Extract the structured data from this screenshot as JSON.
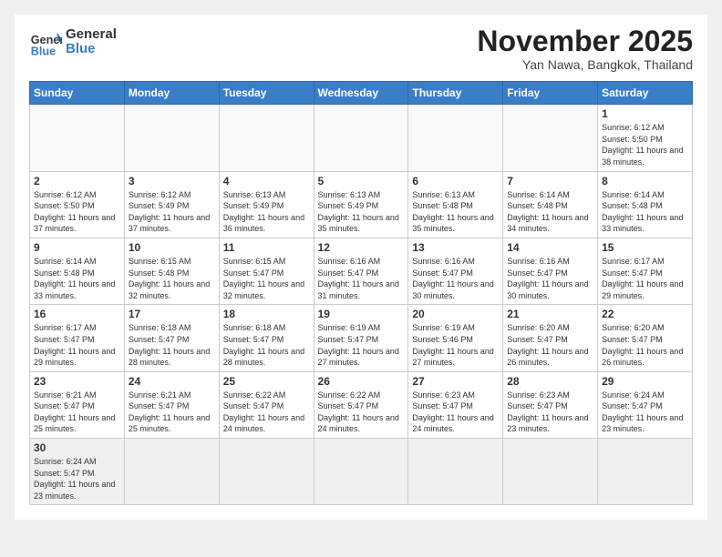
{
  "header": {
    "logo_general": "General",
    "logo_blue": "Blue",
    "month_title": "November 2025",
    "subtitle": "Yan Nawa, Bangkok, Thailand"
  },
  "weekdays": [
    "Sunday",
    "Monday",
    "Tuesday",
    "Wednesday",
    "Thursday",
    "Friday",
    "Saturday"
  ],
  "days": {
    "1": {
      "sunrise": "6:12 AM",
      "sunset": "5:50 PM",
      "daylight": "11 hours and 38 minutes."
    },
    "2": {
      "sunrise": "6:12 AM",
      "sunset": "5:50 PM",
      "daylight": "11 hours and 37 minutes."
    },
    "3": {
      "sunrise": "6:12 AM",
      "sunset": "5:49 PM",
      "daylight": "11 hours and 37 minutes."
    },
    "4": {
      "sunrise": "6:13 AM",
      "sunset": "5:49 PM",
      "daylight": "11 hours and 36 minutes."
    },
    "5": {
      "sunrise": "6:13 AM",
      "sunset": "5:49 PM",
      "daylight": "11 hours and 35 minutes."
    },
    "6": {
      "sunrise": "6:13 AM",
      "sunset": "5:48 PM",
      "daylight": "11 hours and 35 minutes."
    },
    "7": {
      "sunrise": "6:14 AM",
      "sunset": "5:48 PM",
      "daylight": "11 hours and 34 minutes."
    },
    "8": {
      "sunrise": "6:14 AM",
      "sunset": "5:48 PM",
      "daylight": "11 hours and 33 minutes."
    },
    "9": {
      "sunrise": "6:14 AM",
      "sunset": "5:48 PM",
      "daylight": "11 hours and 33 minutes."
    },
    "10": {
      "sunrise": "6:15 AM",
      "sunset": "5:48 PM",
      "daylight": "11 hours and 32 minutes."
    },
    "11": {
      "sunrise": "6:15 AM",
      "sunset": "5:47 PM",
      "daylight": "11 hours and 32 minutes."
    },
    "12": {
      "sunrise": "6:16 AM",
      "sunset": "5:47 PM",
      "daylight": "11 hours and 31 minutes."
    },
    "13": {
      "sunrise": "6:16 AM",
      "sunset": "5:47 PM",
      "daylight": "11 hours and 30 minutes."
    },
    "14": {
      "sunrise": "6:16 AM",
      "sunset": "5:47 PM",
      "daylight": "11 hours and 30 minutes."
    },
    "15": {
      "sunrise": "6:17 AM",
      "sunset": "5:47 PM",
      "daylight": "11 hours and 29 minutes."
    },
    "16": {
      "sunrise": "6:17 AM",
      "sunset": "5:47 PM",
      "daylight": "11 hours and 29 minutes."
    },
    "17": {
      "sunrise": "6:18 AM",
      "sunset": "5:47 PM",
      "daylight": "11 hours and 28 minutes."
    },
    "18": {
      "sunrise": "6:18 AM",
      "sunset": "5:47 PM",
      "daylight": "11 hours and 28 minutes."
    },
    "19": {
      "sunrise": "6:19 AM",
      "sunset": "5:47 PM",
      "daylight": "11 hours and 27 minutes."
    },
    "20": {
      "sunrise": "6:19 AM",
      "sunset": "5:46 PM",
      "daylight": "11 hours and 27 minutes."
    },
    "21": {
      "sunrise": "6:20 AM",
      "sunset": "5:47 PM",
      "daylight": "11 hours and 26 minutes."
    },
    "22": {
      "sunrise": "6:20 AM",
      "sunset": "5:47 PM",
      "daylight": "11 hours and 26 minutes."
    },
    "23": {
      "sunrise": "6:21 AM",
      "sunset": "5:47 PM",
      "daylight": "11 hours and 25 minutes."
    },
    "24": {
      "sunrise": "6:21 AM",
      "sunset": "5:47 PM",
      "daylight": "11 hours and 25 minutes."
    },
    "25": {
      "sunrise": "6:22 AM",
      "sunset": "5:47 PM",
      "daylight": "11 hours and 24 minutes."
    },
    "26": {
      "sunrise": "6:22 AM",
      "sunset": "5:47 PM",
      "daylight": "11 hours and 24 minutes."
    },
    "27": {
      "sunrise": "6:23 AM",
      "sunset": "5:47 PM",
      "daylight": "11 hours and 24 minutes."
    },
    "28": {
      "sunrise": "6:23 AM",
      "sunset": "5:47 PM",
      "daylight": "11 hours and 23 minutes."
    },
    "29": {
      "sunrise": "6:24 AM",
      "sunset": "5:47 PM",
      "daylight": "11 hours and 23 minutes."
    },
    "30": {
      "sunrise": "6:24 AM",
      "sunset": "5:47 PM",
      "daylight": "11 hours and 23 minutes."
    }
  }
}
